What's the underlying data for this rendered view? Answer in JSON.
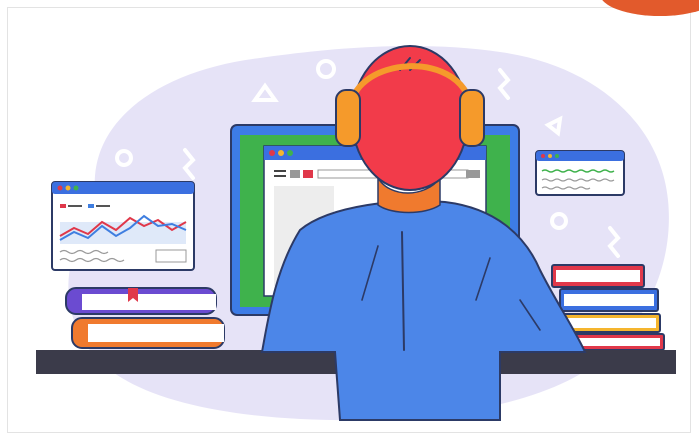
{
  "illustration": {
    "subject": "person-at-computer-with-headphones",
    "colors": {
      "backdrop": "#e6e3f7",
      "backdrop_shape": "#d9d5f2",
      "accent_corner": "#e25a2c",
      "hair": "#f23b4a",
      "headphones": "#f59a2b",
      "shirt": "#4c86e8",
      "shirt_shadow": "#2f66cc",
      "monitor_frame": "#3d7ce6",
      "monitor_screen_green": "#3fb24c",
      "desk": "#3b3b4a",
      "book_purple": "#6b4bd1",
      "book_orange": "#f07a2e",
      "book_red": "#e0384a",
      "book_blue": "#3b6fe0",
      "book_yellow": "#f5b52e",
      "chart_red": "#e0384a",
      "chart_blue": "#3f7ee0"
    }
  }
}
